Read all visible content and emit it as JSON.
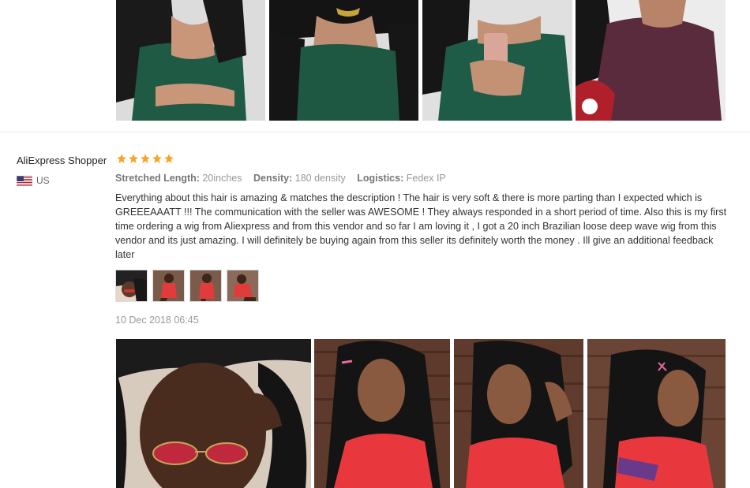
{
  "review": {
    "reviewer_name": "AliExpress Shopper",
    "country": "US",
    "rating": 5,
    "attributes": [
      {
        "label": "Stretched Length:",
        "value": "20inches"
      },
      {
        "label": "Density:",
        "value": "180 density"
      },
      {
        "label": "Logistics:",
        "value": "Fedex IP"
      }
    ],
    "text": "Everything about this hair is amazing & matches the description ! The hair is very soft & there is more parting than I expected which is GREEEAAATT !!! The communication with the seller was AWESOME ! They always responded in a short period of time. Also this is my first time ordering a wig from Aliexpress and from this vendor and so far I am loving it , I got a 20 inch Brazilian loose deep wave wig from this vendor and its just amazing. I will definitely be buying again from this seller its definitely worth the money . Ill give an additional feedback later",
    "date": "10 Dec 2018 06:45"
  },
  "colors": {
    "star": "#f5a623",
    "label": "#777777",
    "muted": "#999999"
  }
}
